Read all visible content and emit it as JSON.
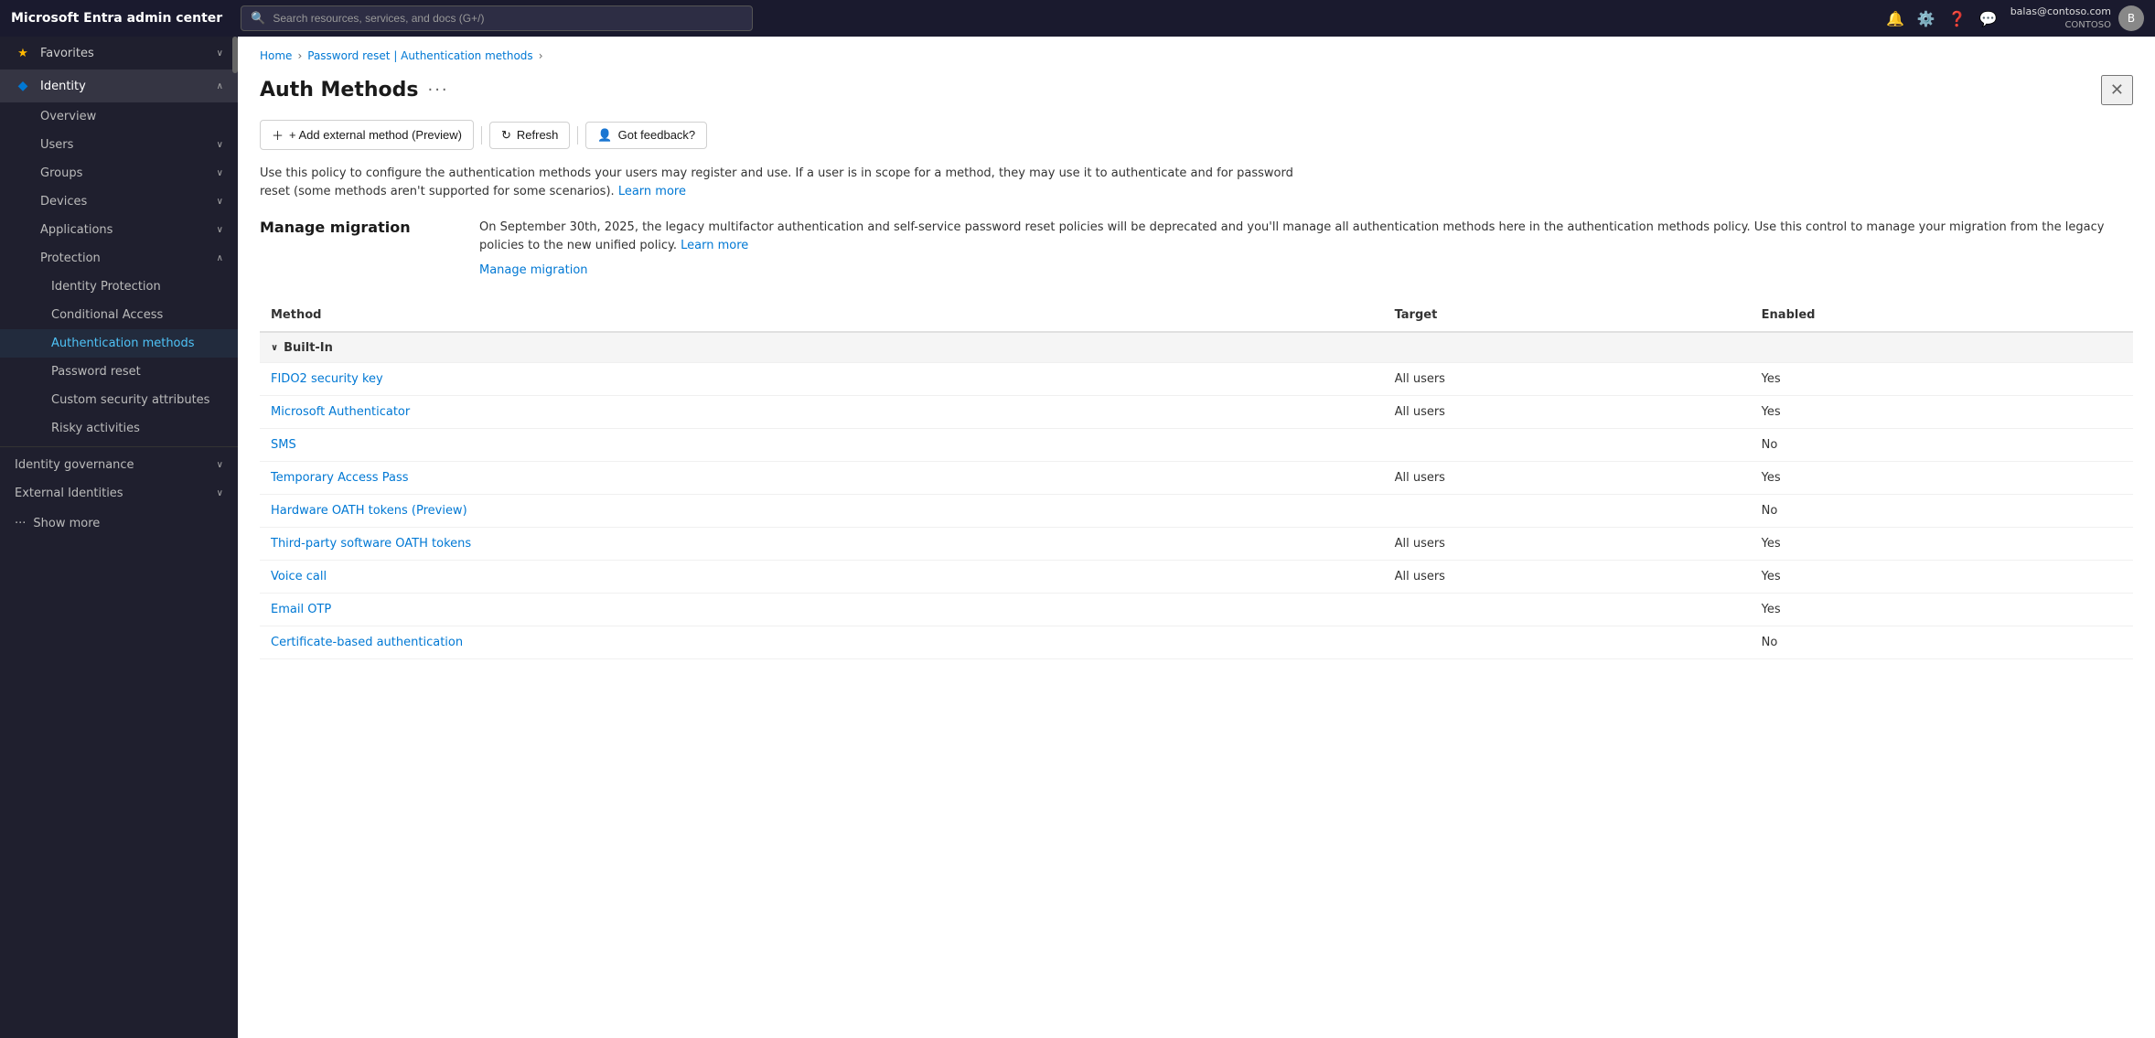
{
  "app": {
    "brand": "Microsoft Entra admin center",
    "search_placeholder": "Search resources, services, and docs (G+/)"
  },
  "user": {
    "email": "balas@contoso.com",
    "org": "CONTOSO"
  },
  "sidebar": {
    "favorites_label": "Favorites",
    "identity_label": "Identity",
    "items": [
      {
        "id": "overview",
        "label": "Overview",
        "icon": "○"
      },
      {
        "id": "users",
        "label": "Users",
        "icon": "👤"
      },
      {
        "id": "groups",
        "label": "Groups",
        "icon": "⊞"
      },
      {
        "id": "devices",
        "label": "Devices",
        "icon": "💻"
      },
      {
        "id": "applications",
        "label": "Applications",
        "icon": "⊞"
      },
      {
        "id": "protection",
        "label": "Protection",
        "icon": "🔒",
        "expanded": true
      }
    ],
    "protection_sub": [
      {
        "id": "identity-protection",
        "label": "Identity Protection"
      },
      {
        "id": "conditional-access",
        "label": "Conditional Access"
      },
      {
        "id": "authentication-methods",
        "label": "Authentication methods",
        "active": true
      },
      {
        "id": "password-reset",
        "label": "Password reset"
      },
      {
        "id": "custom-security-attributes",
        "label": "Custom security attributes"
      },
      {
        "id": "risky-activities",
        "label": "Risky activities"
      }
    ],
    "bottom_items": [
      {
        "id": "identity-governance",
        "label": "Identity governance",
        "icon": "⊞"
      },
      {
        "id": "external-identities",
        "label": "External Identities",
        "icon": "⊞"
      }
    ],
    "show_more": "Show more"
  },
  "breadcrumb": {
    "items": [
      "Home",
      "Password reset | Authentication methods"
    ],
    "current": ""
  },
  "page": {
    "title": "Auth Methods",
    "ellipsis": "···"
  },
  "toolbar": {
    "add_label": "+ Add external method (Preview)",
    "refresh_label": "Refresh",
    "feedback_label": "Got feedback?"
  },
  "description": {
    "text": "Use this policy to configure the authentication methods your users may register and use. If a user is in scope for a method, they may use it to authenticate and for password reset (some methods aren't supported for some scenarios).",
    "learn_more": "Learn more"
  },
  "migration": {
    "title": "Manage migration",
    "text": "On September 30th, 2025, the legacy multifactor authentication and self-service password reset policies will be deprecated and you'll manage all authentication methods here in the authentication methods policy. Use this control to manage your migration from the legacy policies to the new unified policy.",
    "learn_more": "Learn more",
    "link": "Manage migration"
  },
  "table": {
    "columns": [
      "Method",
      "Target",
      "Enabled"
    ],
    "groups": [
      {
        "name": "Built-In",
        "rows": [
          {
            "method": "FIDO2 security key",
            "target": "All users",
            "enabled": "Yes"
          },
          {
            "method": "Microsoft Authenticator",
            "target": "All users",
            "enabled": "Yes"
          },
          {
            "method": "SMS",
            "target": "",
            "enabled": "No"
          },
          {
            "method": "Temporary Access Pass",
            "target": "All users",
            "enabled": "Yes"
          },
          {
            "method": "Hardware OATH tokens (Preview)",
            "target": "",
            "enabled": "No"
          },
          {
            "method": "Third-party software OATH tokens",
            "target": "All users",
            "enabled": "Yes"
          },
          {
            "method": "Voice call",
            "target": "All users",
            "enabled": "Yes"
          },
          {
            "method": "Email OTP",
            "target": "",
            "enabled": "Yes"
          },
          {
            "method": "Certificate-based authentication",
            "target": "",
            "enabled": "No"
          }
        ]
      }
    ]
  }
}
